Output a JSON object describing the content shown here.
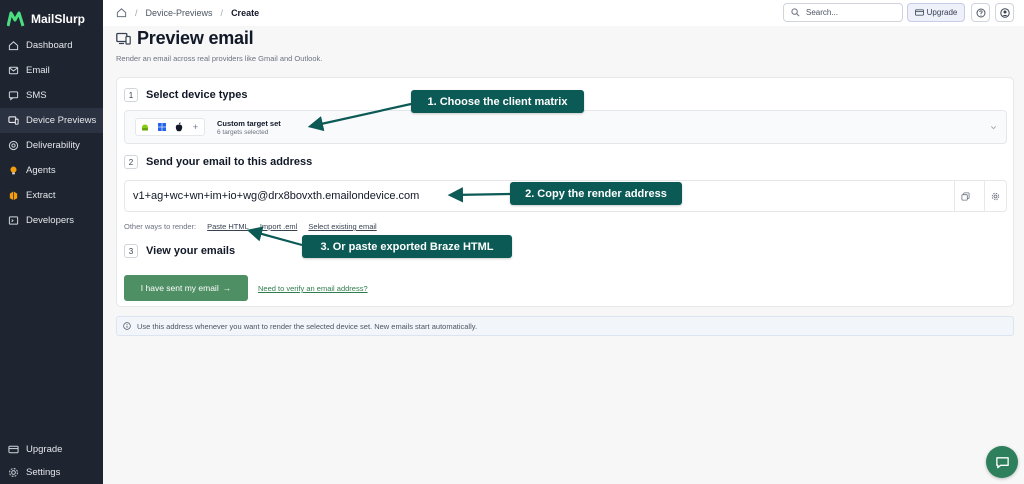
{
  "app": {
    "name": "MailSlurp"
  },
  "sidebar": {
    "items": [
      {
        "label": "Dashboard",
        "icon": "home-icon"
      },
      {
        "label": "Email",
        "icon": "mail-icon"
      },
      {
        "label": "SMS",
        "icon": "message-icon"
      },
      {
        "label": "Device Previews",
        "icon": "devices-icon",
        "active": true
      },
      {
        "label": "Deliverability",
        "icon": "target-icon"
      },
      {
        "label": "Agents",
        "icon": "bulb-icon"
      },
      {
        "label": "Extract",
        "icon": "extract-icon"
      },
      {
        "label": "Developers",
        "icon": "code-icon"
      }
    ],
    "bottom": [
      {
        "label": "Upgrade",
        "icon": "card-icon"
      },
      {
        "label": "Settings",
        "icon": "gear-icon"
      }
    ]
  },
  "topbar": {
    "breadcrumb": [
      "Device-Previews",
      "Create"
    ],
    "search_placeholder": "Search...",
    "upgrade_label": "Upgrade"
  },
  "page": {
    "title": "Preview email",
    "subtitle": "Render an email across real providers like Gmail and Outlook."
  },
  "steps": [
    {
      "num": "1",
      "title": "Select device types"
    },
    {
      "num": "2",
      "title": "Send your email to this address"
    },
    {
      "num": "3",
      "title": "View your emails"
    }
  ],
  "device_select": {
    "name": "Custom target set",
    "count": "6 targets selected",
    "icons": [
      "android-icon",
      "windows-icon",
      "apple-icon",
      "plus-icon"
    ],
    "plus": "+"
  },
  "render_address": "v1+ag+wc+wn+im+io+wg@drx8bovxth.emailondevice.com",
  "other_ways": {
    "prefix": "Other ways to render:",
    "links": [
      "Paste HTML",
      "Import .eml",
      "Select existing email"
    ]
  },
  "sent_button": "I have sent my email",
  "sent_arrow": "→",
  "verify_link": "Need to verify an email address?",
  "info": "Use this address whenever you want to render the selected device set. New emails start automatically.",
  "callouts": [
    "1. Choose the client matrix",
    "2. Copy the render address",
    "3. Or paste exported Braze HTML"
  ],
  "colors": {
    "sidebar": "#1e2430",
    "accent": "#4e8f64",
    "callout": "#0c5a55"
  }
}
